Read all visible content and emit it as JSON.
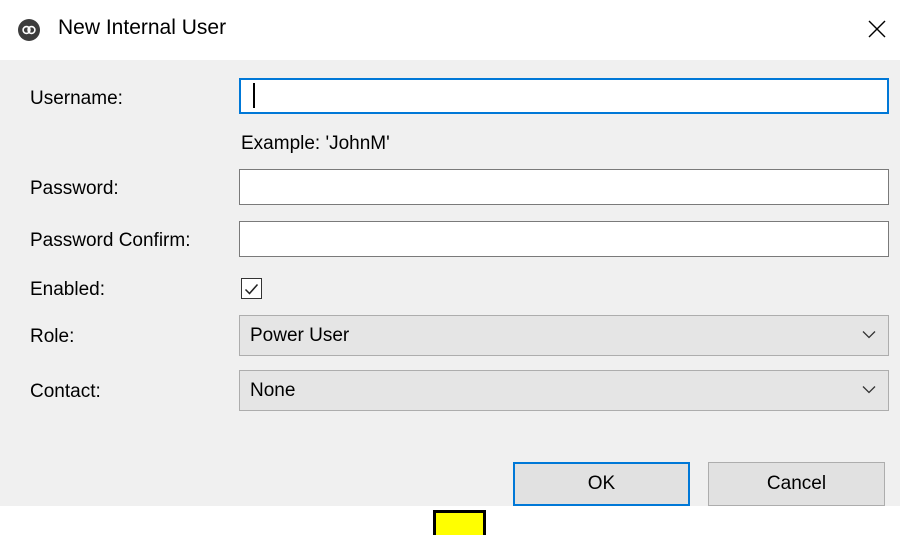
{
  "window": {
    "title": "New Internal User"
  },
  "fields": {
    "username_label": "Username:",
    "username_value": "",
    "username_hint": "Example:  'JohnM'",
    "password_label": "Password:",
    "password_value": "",
    "password_confirm_label": "Password Confirm:",
    "password_confirm_value": "",
    "enabled_label": "Enabled:",
    "enabled_checked": true,
    "role_label": "Role:",
    "role_value": "Power User",
    "contact_label": "Contact:",
    "contact_value": "None"
  },
  "buttons": {
    "ok": "OK",
    "cancel": "Cancel"
  },
  "colors": {
    "focus_accent": "#0078d7",
    "dialog_bg": "#f0f0f0",
    "marker": "#ffff00"
  }
}
